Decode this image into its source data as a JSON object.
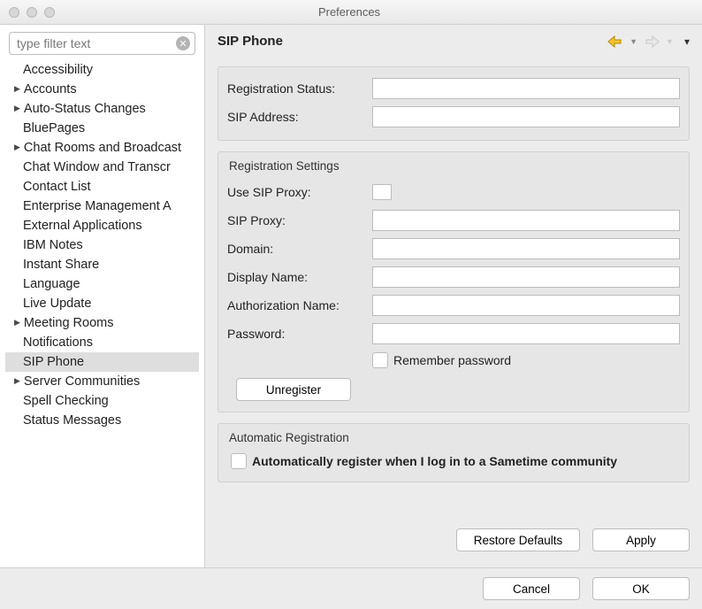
{
  "window": {
    "title": "Preferences"
  },
  "filter": {
    "placeholder": "type filter text"
  },
  "tree": {
    "items": [
      {
        "label": "Accessibility",
        "expandable": false
      },
      {
        "label": "Accounts",
        "expandable": true
      },
      {
        "label": "Auto-Status Changes",
        "expandable": true
      },
      {
        "label": "BluePages",
        "expandable": false
      },
      {
        "label": "Chat Rooms and Broadcast",
        "expandable": true
      },
      {
        "label": "Chat Window and Transcr",
        "expandable": false
      },
      {
        "label": "Contact List",
        "expandable": false
      },
      {
        "label": "Enterprise Management A",
        "expandable": false
      },
      {
        "label": "External Applications",
        "expandable": false
      },
      {
        "label": "IBM Notes",
        "expandable": false
      },
      {
        "label": "Instant Share",
        "expandable": false
      },
      {
        "label": "Language",
        "expandable": false
      },
      {
        "label": "Live Update",
        "expandable": false
      },
      {
        "label": "Meeting Rooms",
        "expandable": true
      },
      {
        "label": "Notifications",
        "expandable": false
      },
      {
        "label": "SIP Phone",
        "expandable": false,
        "selected": true
      },
      {
        "label": "Server Communities",
        "expandable": true
      },
      {
        "label": "Spell Checking",
        "expandable": false
      },
      {
        "label": "Status Messages",
        "expandable": false
      }
    ]
  },
  "panel": {
    "title": "SIP Phone",
    "status_group": {
      "reg_status_label": "Registration Status:",
      "reg_status_value": "",
      "sip_address_label": "SIP Address:",
      "sip_address_value": ""
    },
    "reg_settings": {
      "title": "Registration Settings",
      "use_proxy_label": "Use SIP Proxy:",
      "sip_proxy_label": "SIP Proxy:",
      "sip_proxy_value": "",
      "domain_label": "Domain:",
      "domain_value": "",
      "display_name_label": "Display Name:",
      "display_name_value": "",
      "auth_name_label": "Authorization Name:",
      "auth_name_value": "",
      "password_label": "Password:",
      "password_value": "",
      "remember_label": "Remember password",
      "unregister_label": "Unregister"
    },
    "auto_reg": {
      "title": "Automatic Registration",
      "checkbox_label": "Automatically register when I log in to a Sametime community"
    },
    "buttons": {
      "restore_defaults": "Restore Defaults",
      "apply": "Apply"
    }
  },
  "footer": {
    "cancel": "Cancel",
    "ok": "OK"
  }
}
